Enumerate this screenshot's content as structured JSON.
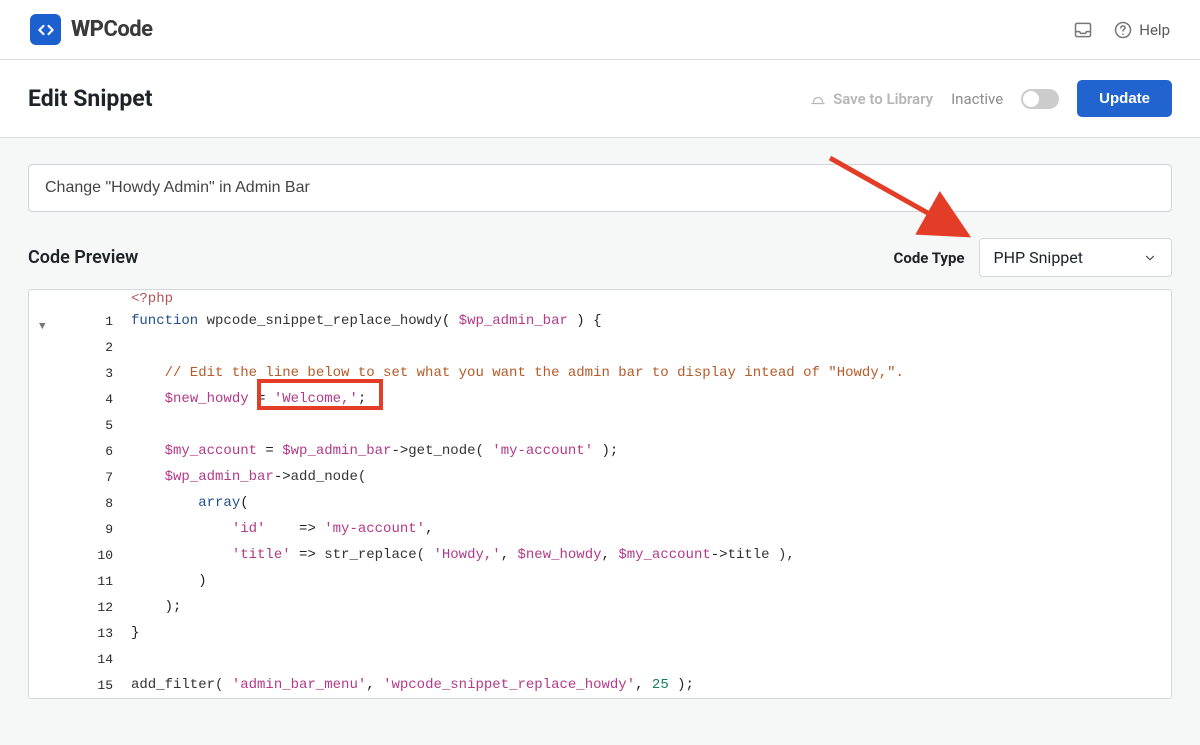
{
  "header": {
    "brand_prefix": "WP",
    "brand_suffix": "Code",
    "help_label": "Help"
  },
  "subheader": {
    "title": "Edit Snippet",
    "save_library": "Save to Library",
    "inactive_label": "Inactive",
    "update_label": "Update"
  },
  "snippet": {
    "title": "Change \"Howdy Admin\" in Admin Bar"
  },
  "preview": {
    "label": "Code Preview",
    "code_type_label": "Code Type",
    "code_type_value": "PHP Snippet"
  },
  "code": {
    "php_open": "<?php",
    "l1_function": "function",
    "l1_fn_name": " wpcode_snippet_replace_howdy",
    "l1_paren_open": "( ",
    "l1_param": "$wp_admin_bar",
    "l1_rest": " ) {",
    "l3_comment": "    // Edit the line below to set what you want the admin bar to display intead of \"Howdy,\".",
    "l4_indent": "    ",
    "l4_var": "$new_howdy",
    "l4_eq": " = ",
    "l4_str": "'Welcome,'",
    "l4_semi": ";",
    "l6_indent": "    ",
    "l6_var": "$my_account",
    "l6_eq": " = ",
    "l6_obj": "$wp_admin_bar",
    "l6_arrow": "->",
    "l6_meth": "get_node( ",
    "l6_arg": "'my-account'",
    "l6_end": " );",
    "l7_indent": "    ",
    "l7_obj": "$wp_admin_bar",
    "l7_arrow": "->",
    "l7_meth": "add_node(",
    "l8_indent": "        ",
    "l8_array": "array",
    "l8_paren": "(",
    "l9_indent": "            ",
    "l9_key": "'id'",
    "l9_arrow": "    => ",
    "l9_val": "'my-account'",
    "l9_comma": ",",
    "l10_indent": "            ",
    "l10_key": "'title'",
    "l10_arrow": " => ",
    "l10_fn": "str_replace( ",
    "l10_arg1": "'Howdy,'",
    "l10_c1": ", ",
    "l10_arg2": "$new_howdy",
    "l10_c2": ", ",
    "l10_arg3": "$my_account",
    "l10_arr2": "->",
    "l10_prop": "title ),",
    "l11_indent": "        ",
    "l11_close": ")",
    "l12_indent": "    ",
    "l12_close": ");",
    "l13": "}",
    "l15_fn": "add_filter( ",
    "l15_arg1": "'admin_bar_menu'",
    "l15_c1": ", ",
    "l15_arg2": "'wpcode_snippet_replace_howdy'",
    "l15_c2": ", ",
    "l15_num": "25",
    "l15_end": " );"
  },
  "line_numbers": [
    "1",
    "2",
    "3",
    "4",
    "5",
    "6",
    "7",
    "8",
    "9",
    "10",
    "11",
    "12",
    "13",
    "14",
    "15"
  ]
}
